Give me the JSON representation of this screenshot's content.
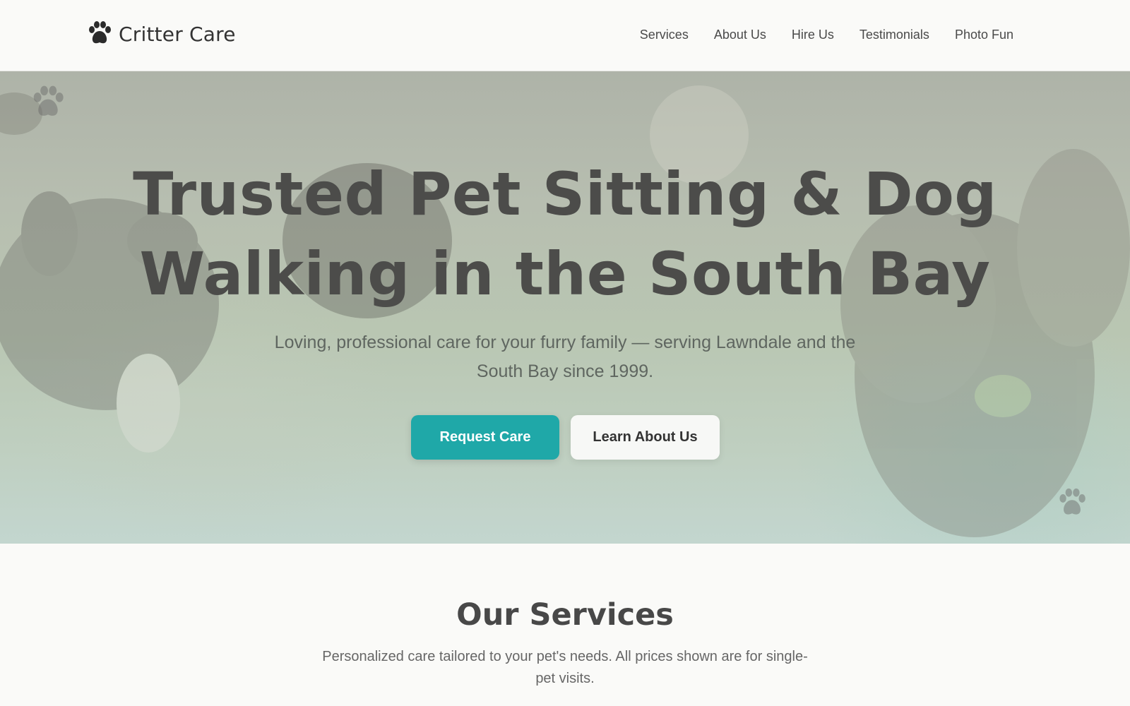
{
  "header": {
    "brand_name": "Critter Care",
    "brand_icon": "paw-icon",
    "nav": [
      {
        "label": "Services"
      },
      {
        "label": "About Us"
      },
      {
        "label": "Hire Us"
      },
      {
        "label": "Testimonials"
      },
      {
        "label": "Photo Fun"
      }
    ]
  },
  "hero": {
    "title_line1": "Trusted Pet Sitting & Dog",
    "title_line2": "Walking in the South Bay",
    "subtitle": "Loving, professional care for your furry family — serving Lawndale and the South Bay since 1999.",
    "primary_button": "Request Care",
    "secondary_button": "Learn About Us",
    "decor_icons": [
      "paw-icon",
      "paw-icon"
    ]
  },
  "services": {
    "title": "Our Services",
    "description": "Personalized care tailored to your pet's needs. All prices shown are for single-pet visits."
  },
  "colors": {
    "accent": "#1fa8a8",
    "background": "#fafaf8",
    "heading": "#4c4c4a"
  }
}
